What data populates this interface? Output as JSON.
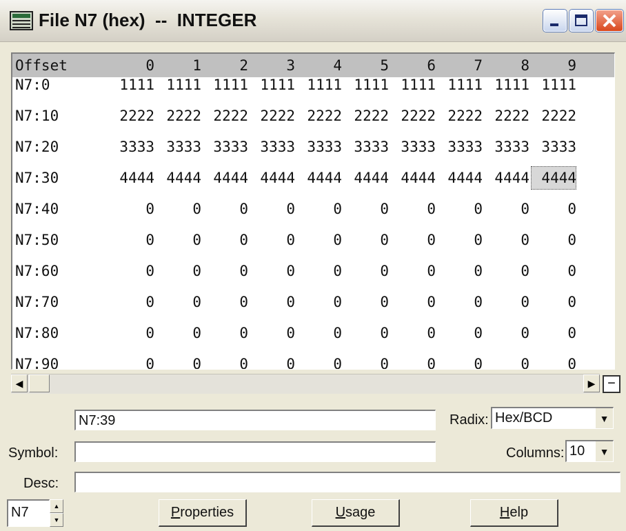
{
  "window": {
    "title": "File N7 (hex)  --  INTEGER"
  },
  "table": {
    "offset_header": "Offset",
    "columns": [
      "0",
      "1",
      "2",
      "3",
      "4",
      "5",
      "6",
      "7",
      "8",
      "9"
    ],
    "rows": [
      {
        "label": "N7:0",
        "values": [
          "1111",
          "1111",
          "1111",
          "1111",
          "1111",
          "1111",
          "1111",
          "1111",
          "1111",
          "1111"
        ]
      },
      {
        "label": "N7:10",
        "values": [
          "2222",
          "2222",
          "2222",
          "2222",
          "2222",
          "2222",
          "2222",
          "2222",
          "2222",
          "2222"
        ]
      },
      {
        "label": "N7:20",
        "values": [
          "3333",
          "3333",
          "3333",
          "3333",
          "3333",
          "3333",
          "3333",
          "3333",
          "3333",
          "3333"
        ]
      },
      {
        "label": "N7:30",
        "values": [
          "4444",
          "4444",
          "4444",
          "4444",
          "4444",
          "4444",
          "4444",
          "4444",
          "4444",
          "4444"
        ]
      },
      {
        "label": "N7:40",
        "values": [
          "0",
          "0",
          "0",
          "0",
          "0",
          "0",
          "0",
          "0",
          "0",
          "0"
        ]
      },
      {
        "label": "N7:50",
        "values": [
          "0",
          "0",
          "0",
          "0",
          "0",
          "0",
          "0",
          "0",
          "0",
          "0"
        ]
      },
      {
        "label": "N7:60",
        "values": [
          "0",
          "0",
          "0",
          "0",
          "0",
          "0",
          "0",
          "0",
          "0",
          "0"
        ]
      },
      {
        "label": "N7:70",
        "values": [
          "0",
          "0",
          "0",
          "0",
          "0",
          "0",
          "0",
          "0",
          "0",
          "0"
        ]
      },
      {
        "label": "N7:80",
        "values": [
          "0",
          "0",
          "0",
          "0",
          "0",
          "0",
          "0",
          "0",
          "0",
          "0"
        ]
      },
      {
        "label": "N7:90",
        "values": [
          "0",
          "0",
          "0",
          "0",
          "0",
          "0",
          "0",
          "0",
          "0",
          "0"
        ]
      }
    ],
    "selected_address": "N7:39"
  },
  "controls": {
    "address_value": "N7:39",
    "radix_label": "Radix:",
    "radix_value": "Hex/BCD",
    "symbol_label": "Symbol:",
    "symbol_value": "",
    "columns_label": "Columns:",
    "columns_value": "10",
    "desc_label": "Desc:",
    "desc_value": "",
    "file_value": "N7"
  },
  "buttons": {
    "properties": "Properties",
    "usage": "Usage",
    "help": "Help"
  },
  "colors": {
    "header_bg": "#c0c0c0",
    "window_bg": "#ece9d8",
    "close_red": "#d9481d"
  }
}
